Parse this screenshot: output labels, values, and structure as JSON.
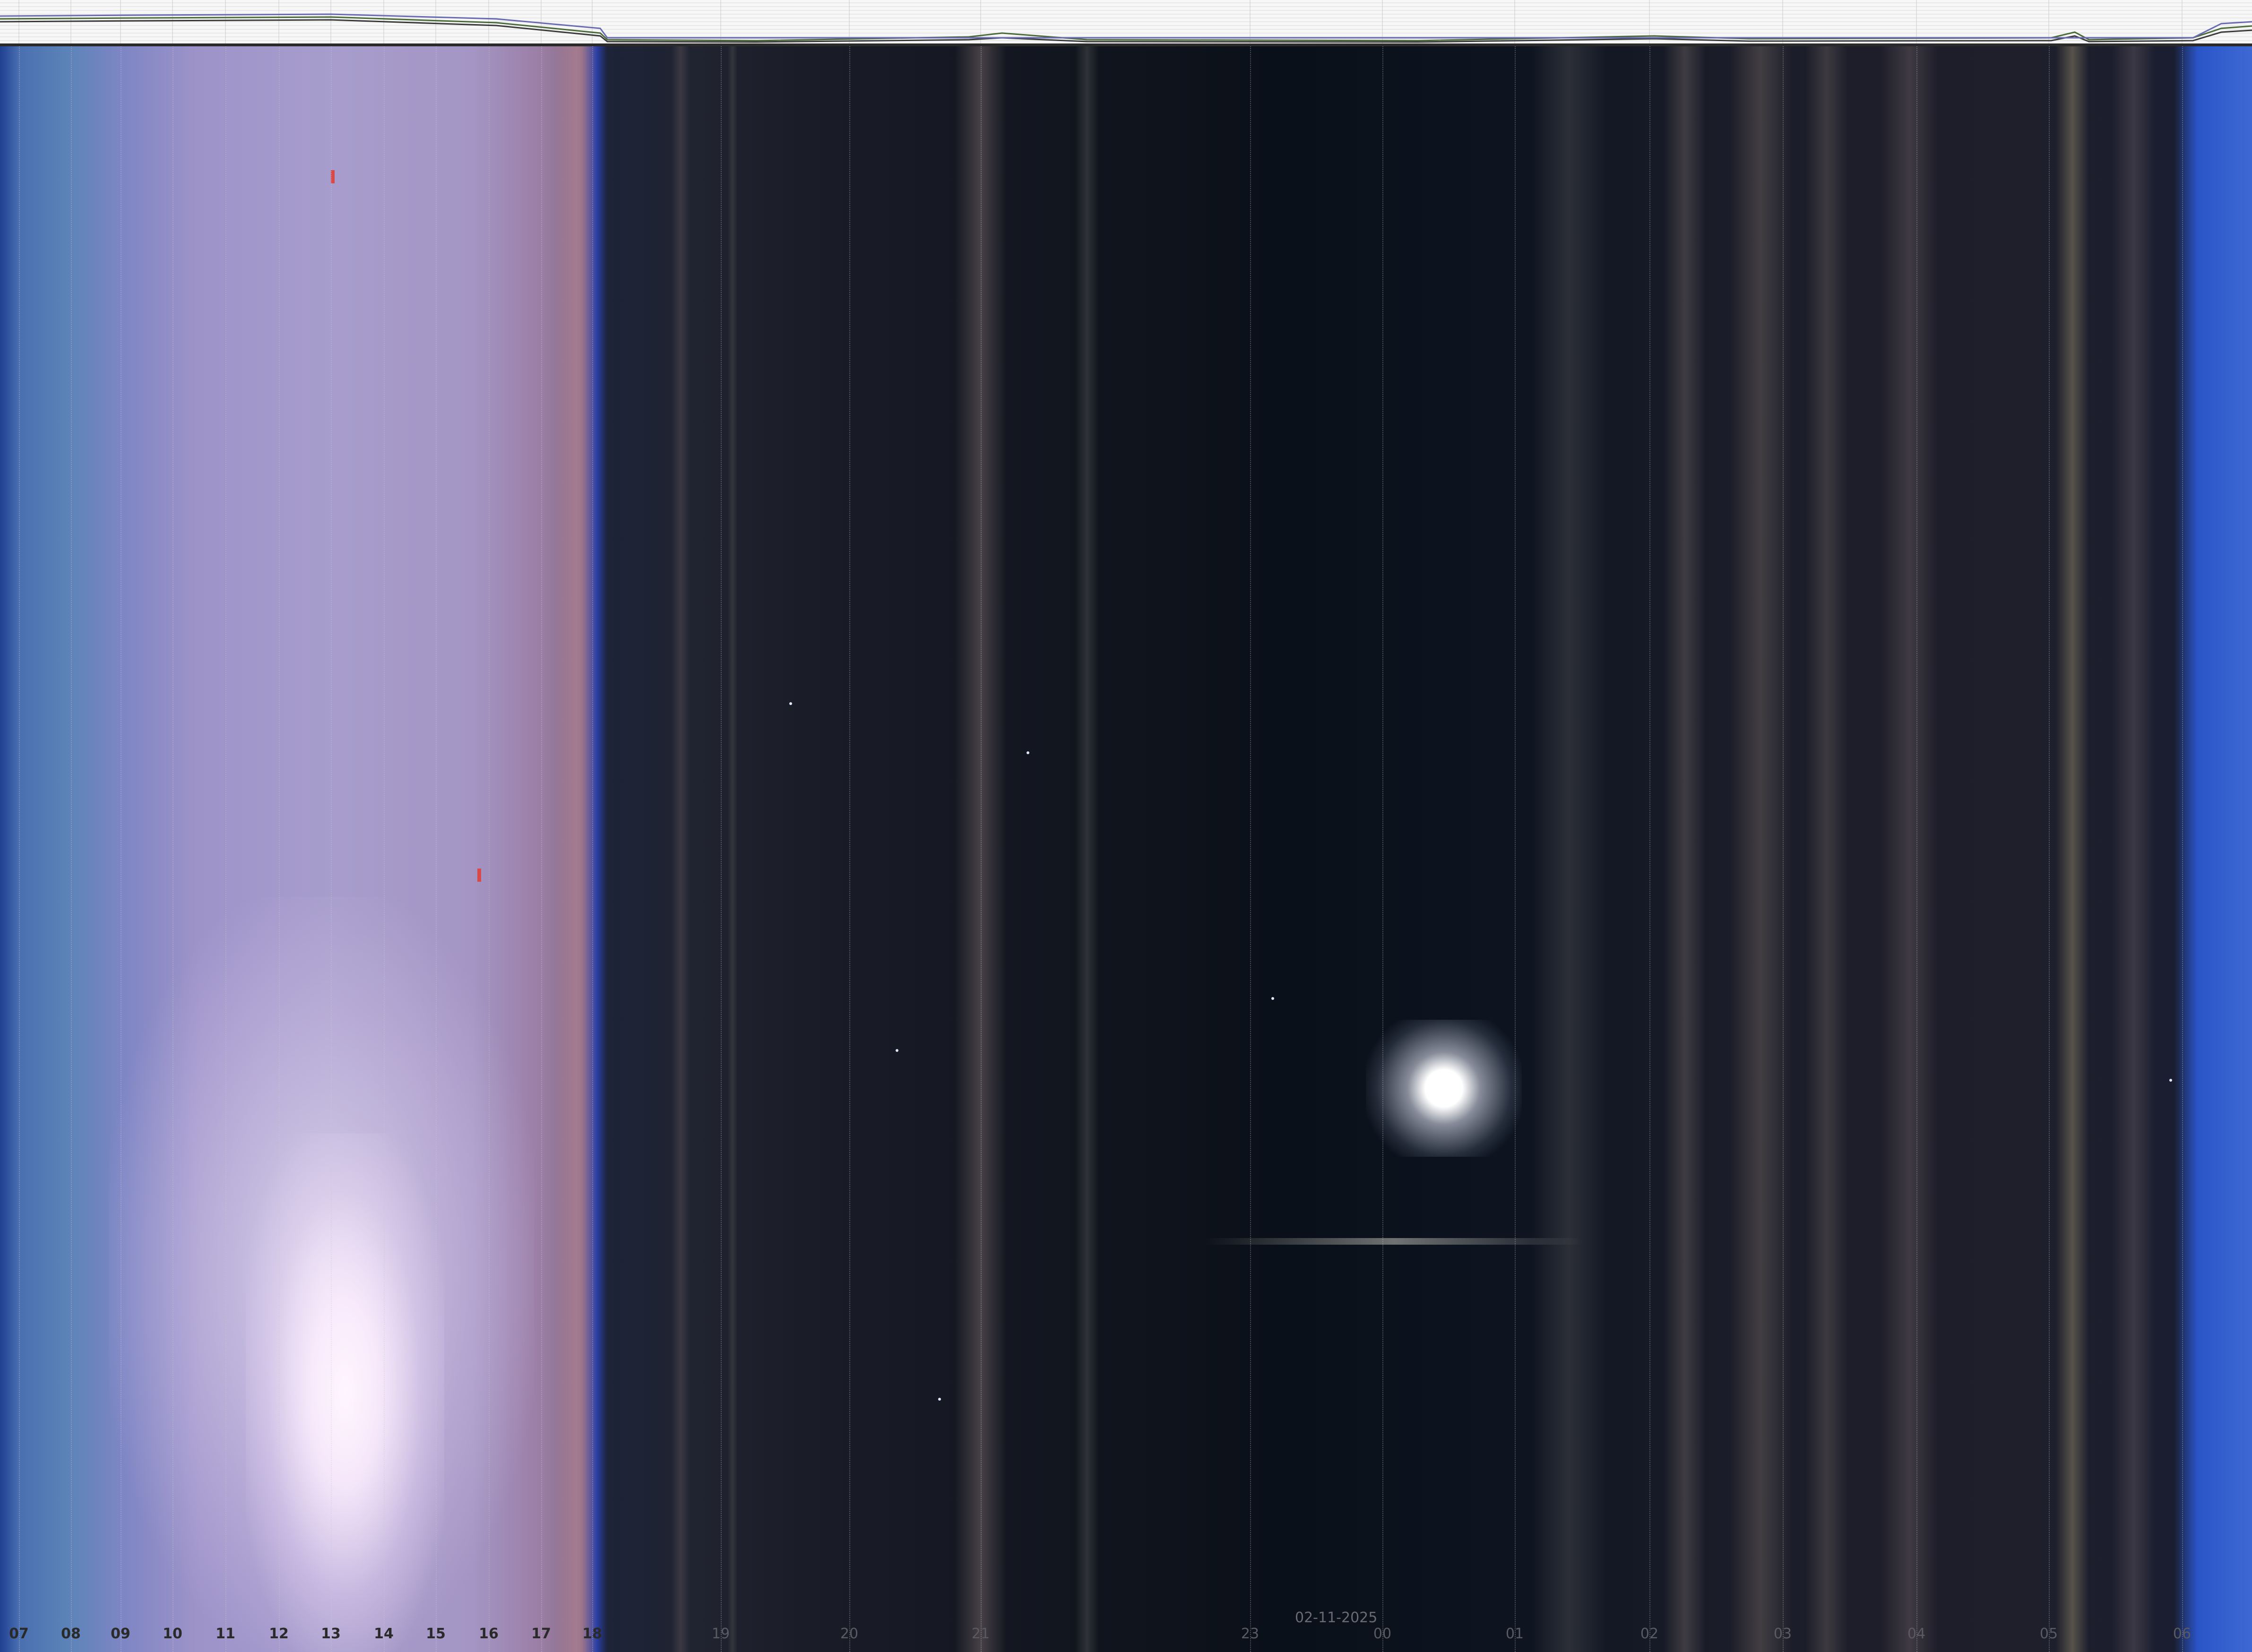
{
  "date_label": "02-11-2025",
  "hours_day": [
    "07",
    "08",
    "09",
    "10",
    "11",
    "12",
    "13",
    "14",
    "15",
    "16",
    "17",
    "18"
  ],
  "hours_night": [
    "19",
    "20",
    "21",
    "23",
    "00",
    "01",
    "02",
    "03",
    "04",
    "05",
    "06"
  ],
  "colors": {
    "header_bg": "#f7f7f7",
    "day_sky": "#9e93c9",
    "night_sky": "#0c1017",
    "dawn_dusk_blue": "#2a55c8",
    "label_dark": "#2a2a2a",
    "label_grey": "#6a6a72"
  }
}
